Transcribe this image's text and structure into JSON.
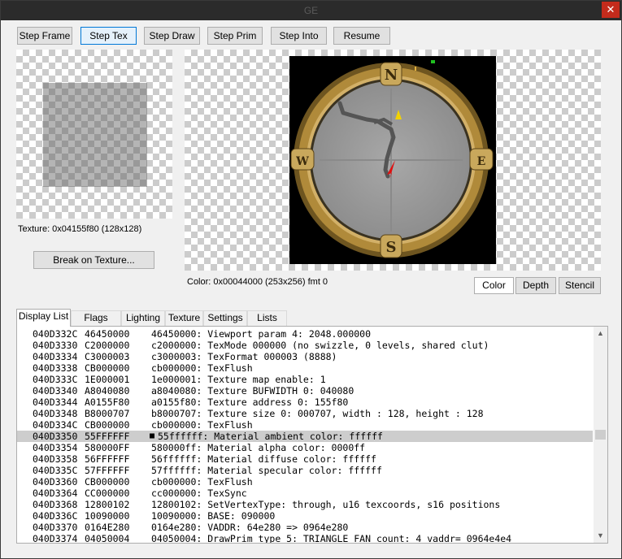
{
  "window": {
    "title": "GE",
    "close_glyph": "✕"
  },
  "toolbar": {
    "step_frame": "Step Frame",
    "step_tex": "Step Tex",
    "step_draw": "Step Draw",
    "step_prim": "Step Prim",
    "step_into": "Step Into",
    "resume": "Resume"
  },
  "texture": {
    "info": "Texture: 0x04155f80 (128x128)",
    "break_button": "Break on Texture..."
  },
  "framebuffer": {
    "info": "Color: 0x00044000 (253x256) fmt 0",
    "modes": [
      "Color",
      "Depth",
      "Stencil"
    ],
    "selected_mode": "Color",
    "compass_letters": {
      "north": "N",
      "south": "S",
      "east": "E",
      "west": "W"
    }
  },
  "tabs": [
    "Display List",
    "Flags",
    "Lighting",
    "Texture",
    "Settings",
    "Lists"
  ],
  "active_tab": "Display List",
  "display_list": {
    "rows": [
      {
        "addr": "040D332C",
        "op": "46450000",
        "desc": "46450000: Viewport param 4: 2048.000000"
      },
      {
        "addr": "040D3330",
        "op": "C2000000",
        "desc": "c2000000: TexMode 000000 (no swizzle, 0 levels, shared clut)"
      },
      {
        "addr": "040D3334",
        "op": "C3000003",
        "desc": "c3000003: TexFormat 000003 (8888)"
      },
      {
        "addr": "040D3338",
        "op": "CB000000",
        "desc": "cb000000: TexFlush"
      },
      {
        "addr": "040D333C",
        "op": "1E000001",
        "desc": "1e000001: Texture map enable: 1"
      },
      {
        "addr": "040D3340",
        "op": "A8040080",
        "desc": "a8040080: Texture BUFWIDTH 0: 040080"
      },
      {
        "addr": "040D3344",
        "op": "A0155F80",
        "desc": "a0155f80: Texture address 0: 155f80"
      },
      {
        "addr": "040D3348",
        "op": "B8000707",
        "desc": "b8000707: Texture size 0: 000707, width : 128, height : 128"
      },
      {
        "addr": "040D334C",
        "op": "CB000000",
        "desc": "cb000000: TexFlush"
      },
      {
        "addr": "040D3350",
        "op": "55FFFFFF",
        "desc": "55ffffff: Material ambient color: ffffff",
        "selected": true,
        "marker": "■"
      },
      {
        "addr": "040D3354",
        "op": "580000FF",
        "desc": "580000ff: Material alpha color: 0000ff"
      },
      {
        "addr": "040D3358",
        "op": "56FFFFFF",
        "desc": "56ffffff: Material diffuse color: ffffff"
      },
      {
        "addr": "040D335C",
        "op": "57FFFFFF",
        "desc": "57ffffff: Material specular color: ffffff"
      },
      {
        "addr": "040D3360",
        "op": "CB000000",
        "desc": "cb000000: TexFlush"
      },
      {
        "addr": "040D3364",
        "op": "CC000000",
        "desc": "cc000000: TexSync"
      },
      {
        "addr": "040D3368",
        "op": "12800102",
        "desc": "12800102: SetVertexType: through, u16 texcoords, s16 positions"
      },
      {
        "addr": "040D336C",
        "op": "10090000",
        "desc": "10090000: BASE: 090000"
      },
      {
        "addr": "040D3370",
        "op": "0164E280",
        "desc": "0164e280: VADDR: 64e280 => 0964e280"
      },
      {
        "addr": "040D3374",
        "op": "04050004",
        "desc": "04050004: DrawPrim type 5: TRIANGLE_FAN count: 4 vaddr= 0964e4e4"
      }
    ]
  },
  "colors": {
    "close_red": "#c42b1c",
    "selection_grey": "#cdcdcd",
    "ring_gold": "#b08a3a",
    "dial_grey": "#9c9c9c",
    "player_red": "#e01010",
    "marker_yellow": "#f2d200"
  }
}
